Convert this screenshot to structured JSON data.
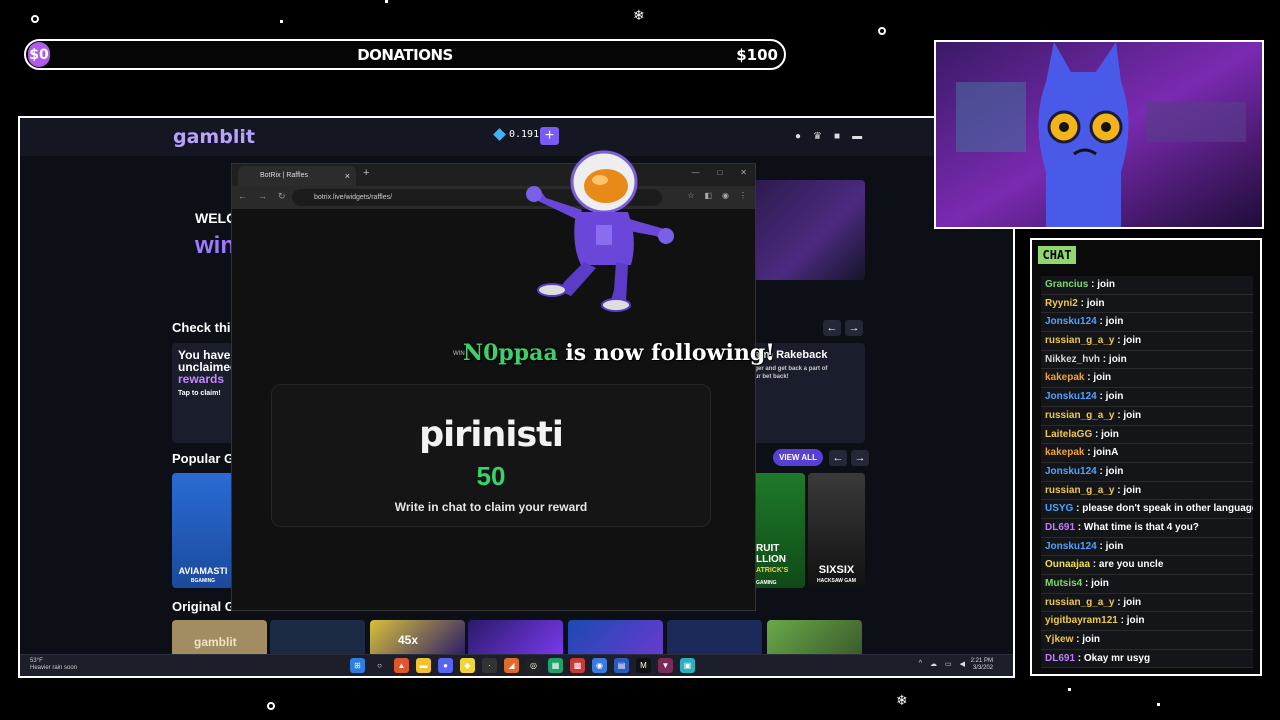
{
  "donations": {
    "start": "$0",
    "title": "DONATIONS",
    "goal": "$100"
  },
  "site": {
    "logo": "gamblit",
    "balance": "0.191",
    "deposit_label": "+",
    "welcome": "WELC",
    "welcome_big": "win",
    "check_title": "Check thi",
    "card1_line1": "You have",
    "card1_line2": "unclaimed",
    "card1_line3": "rewards",
    "card1_sub": "Tap to claim!",
    "card2_title": "laim Rakeback",
    "card2_sub": "ager and get back a part of",
    "card2_sub2": "our bet back!",
    "popular_title": "Popular G",
    "view_all": "VIEW ALL",
    "original_title": "Original G",
    "game1": "AVIAMASTI",
    "game1_sub": "BGAMING",
    "game2_line1": "RUIT",
    "game2_line2": "LLION",
    "game2_line3": "ATRICK'S",
    "game2_sub": "GAMING",
    "game3": "SIXSIX",
    "game3_sub": "HACKSAW GAM",
    "tile_logo": "gamblit",
    "tile_45x": "45x",
    "arrow_left": "←",
    "arrow_right": "→"
  },
  "taskbar": {
    "temp": "53°F",
    "weather": "Heavier rain soon",
    "time": "2:21 PM",
    "date": "3/3/202"
  },
  "browser": {
    "tab_title": "BotRix | Raffles",
    "tab_close": "×",
    "new_tab": "+",
    "url": "botrix.live/widgets/raffles/",
    "raffle_user": "pirinisti",
    "raffle_amount": "50",
    "raffle_instruction": "Write in chat to claim your reward",
    "win_label": "WIN"
  },
  "alert": {
    "username": "N0ppaa",
    "text": " is now following!"
  },
  "chat": {
    "header": "CHAT",
    "messages": [
      {
        "user": "Grancius",
        "text": "join",
        "color": "#7cd96a"
      },
      {
        "user": "Ryyni2",
        "text": "join",
        "color": "#f0c94a"
      },
      {
        "user": "Jonsku124",
        "text": "join",
        "color": "#4fa3ff"
      },
      {
        "user": "russian_g_a_y",
        "text": "join",
        "color": "#f0c94a"
      },
      {
        "user": "Nikkez_hvh",
        "text": "join",
        "color": "#d9d9d9"
      },
      {
        "user": "kakepak",
        "text": "join",
        "color": "#f2a33a"
      },
      {
        "user": "Jonsku124",
        "text": "join",
        "color": "#4fa3ff"
      },
      {
        "user": "russian_g_a_y",
        "text": "join",
        "color": "#f0c94a"
      },
      {
        "user": "LaitelaGG",
        "text": "join",
        "color": "#f0c94a"
      },
      {
        "user": "kakepak",
        "text": "joinA",
        "color": "#f2a33a"
      },
      {
        "user": "Jonsku124",
        "text": "join",
        "color": "#4fa3ff"
      },
      {
        "user": "russian_g_a_y",
        "text": "join",
        "color": "#f0c94a"
      },
      {
        "user": "USYG",
        "text": "please don't speak in other language",
        "color": "#4fa3ff"
      },
      {
        "user": "DL691",
        "text": "What time is that 4 you?",
        "color": "#c07cff"
      },
      {
        "user": "Jonsku124",
        "text": "join",
        "color": "#4fa3ff"
      },
      {
        "user": "Ounaajaa",
        "text": "are you uncle",
        "color": "#f0e04a"
      },
      {
        "user": "Mutsis4",
        "text": "join",
        "color": "#7cd96a"
      },
      {
        "user": "russian_g_a_y",
        "text": "join",
        "color": "#f0c94a"
      },
      {
        "user": "yigitbayram121",
        "text": "join",
        "color": "#f0c94a"
      },
      {
        "user": "Yjkew",
        "text": "join",
        "color": "#f0c94a"
      },
      {
        "user": "DL691",
        "text": "Okay mr usyg",
        "color": "#c07cff"
      }
    ]
  },
  "colors": {
    "accent": "#7a5cf3",
    "follow_name": "#3ed06b",
    "raffle_amount": "#38d36a",
    "chat_header": "#8fd76e"
  }
}
